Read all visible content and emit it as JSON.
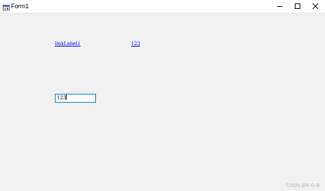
{
  "window": {
    "title": "Form1",
    "icon": "winforms-app-icon",
    "controls": {
      "minimize": "minimize-icon",
      "maximize": "maximize-icon",
      "close": "close-icon"
    }
  },
  "form": {
    "link_label_1": "linkLabel1",
    "link_label_2": "123",
    "textbox_value": "123"
  },
  "watermark": "CSDN @R-G-B",
  "colors": {
    "link": "#0000ff",
    "textbox_border": "#0078d7",
    "client_background": "#f0f0f0"
  }
}
